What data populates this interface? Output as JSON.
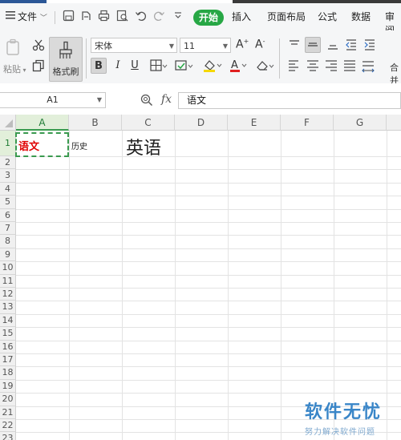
{
  "menubar": {
    "file_label": "文件",
    "tabs": [
      {
        "label": "开始",
        "active": true
      },
      {
        "label": "插入"
      },
      {
        "label": "页面布局"
      },
      {
        "label": "公式"
      },
      {
        "label": "数据"
      },
      {
        "label": "审阅"
      }
    ]
  },
  "ribbon": {
    "paste_label": "粘贴",
    "format_painter_label": "格式刷",
    "font_name": "宋体",
    "font_size": "11",
    "italic_label": "I",
    "bold_label": "B",
    "underline_label": "U",
    "font_color": "#e02020",
    "highlight_color": "#f5d800",
    "merge_label": "合并"
  },
  "formula_bar": {
    "name_box": "A1",
    "fx_label": "fx",
    "content": "语文"
  },
  "sheet": {
    "columns": [
      "A",
      "B",
      "C",
      "D",
      "E",
      "F",
      "G"
    ],
    "rows": [
      "1",
      "2",
      "3",
      "4",
      "5",
      "6",
      "7",
      "8",
      "9",
      "10",
      "11",
      "12",
      "13",
      "14",
      "15",
      "16",
      "17",
      "18",
      "19",
      "20",
      "21",
      "22",
      "23"
    ],
    "selected_cell": "A1",
    "cells": {
      "a1": "语文",
      "b1": "历史",
      "c1": "英语"
    },
    "a1_color": "#e00000"
  },
  "watermark": {
    "title": "软件无忧",
    "subtitle": "努力解决软件问题"
  }
}
